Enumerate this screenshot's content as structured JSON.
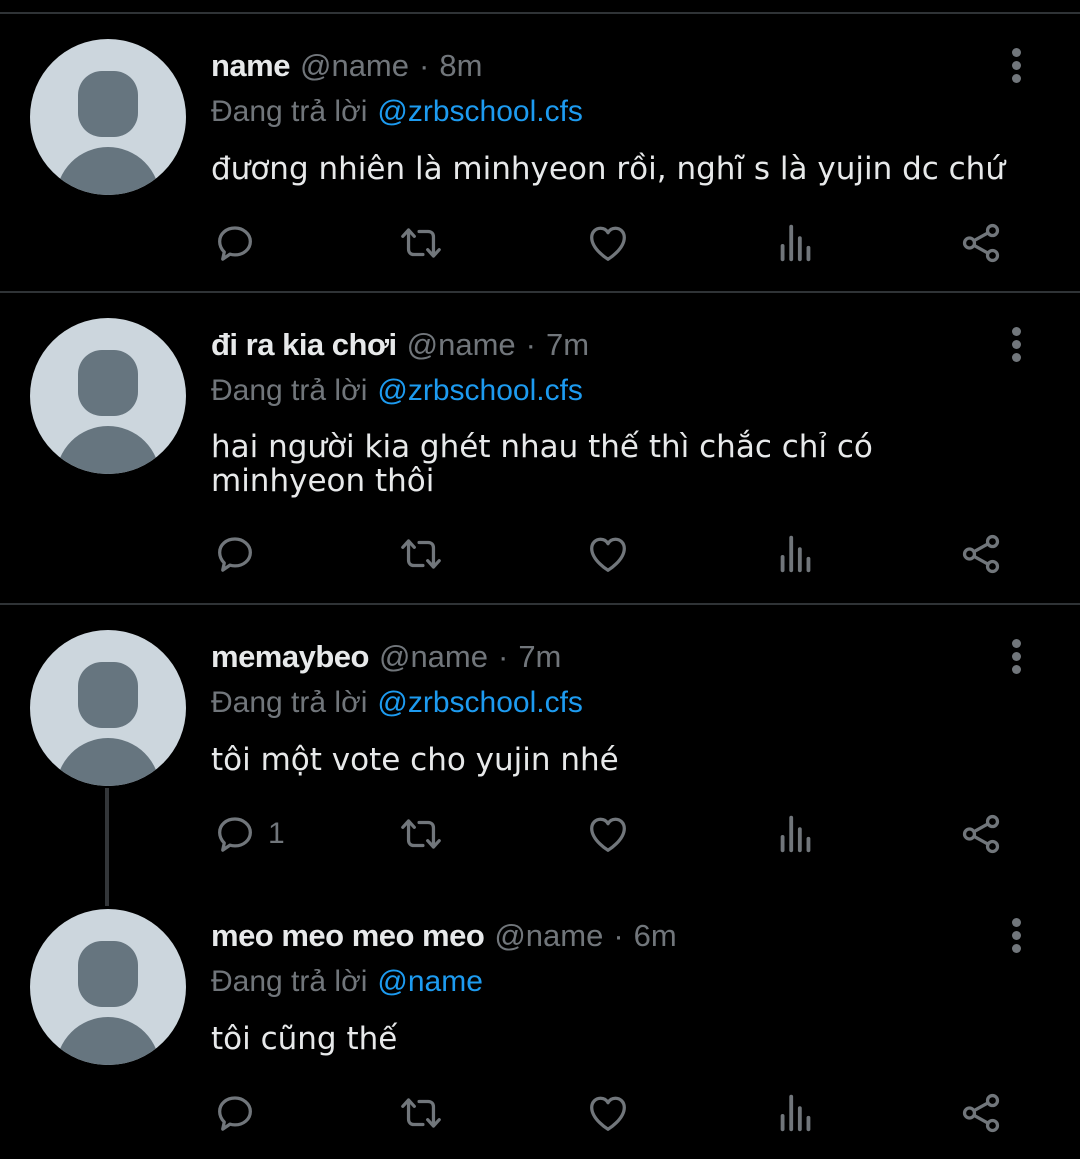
{
  "colors": {
    "background": "#000000",
    "text": "#e7e9ea",
    "muted": "#71767b",
    "link": "#1d9bf0",
    "divider": "#2f3336"
  },
  "icons": {
    "reply": "comment-icon",
    "retweet": "retweet-icon",
    "like": "heart-icon",
    "views": "bar-chart-icon",
    "share": "share-icon",
    "more": "more-vertical-icon",
    "avatar": "default-avatar"
  },
  "tweets": [
    {
      "name": "name",
      "handle": "@name",
      "sep": "·",
      "time": "8m",
      "reply_prefix": "Đang trả lời",
      "reply_to": "@zrbschool.cfs",
      "text": "đương nhiên là minhyeon rồi, nghĩ s là yujin dc chứ",
      "reply_count": ""
    },
    {
      "name": "đi ra kia chơi",
      "handle": "@name",
      "sep": "·",
      "time": "7m",
      "reply_prefix": "Đang trả lời",
      "reply_to": "@zrbschool.cfs",
      "text": "hai người kia ghét nhau thế thì chắc chỉ có minhyeon thôi",
      "reply_count": ""
    },
    {
      "name": "memaybeo",
      "handle": "@name",
      "sep": "·",
      "time": "7m",
      "reply_prefix": "Đang trả lời",
      "reply_to": "@zrbschool.cfs",
      "text": "tôi một vote cho yujin nhé",
      "reply_count": "1"
    },
    {
      "name": "meo meo meo meo",
      "handle": "@name",
      "sep": "·",
      "time": "6m",
      "reply_prefix": "Đang trả lời",
      "reply_to": "@name",
      "text": "tôi cũng thế",
      "reply_count": ""
    }
  ]
}
